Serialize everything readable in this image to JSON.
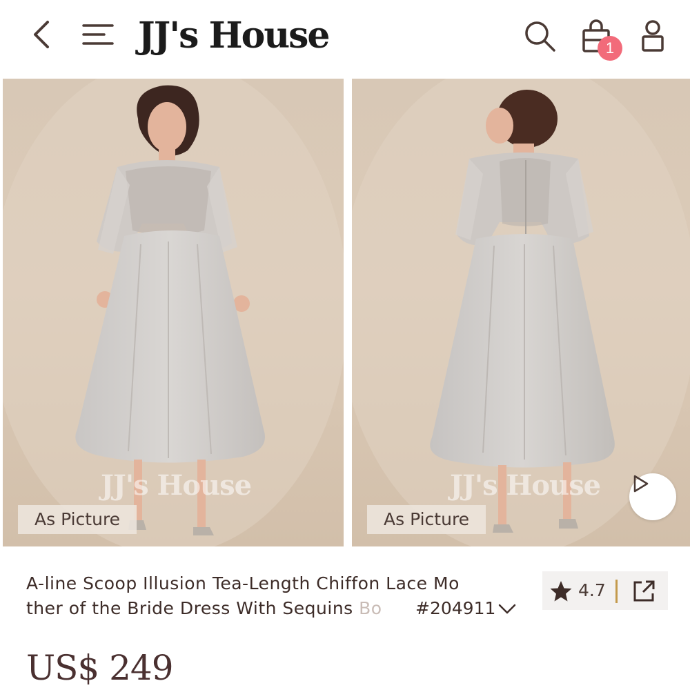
{
  "header": {
    "back_icon": "chevron-left-icon",
    "menu_icon": "hamburger-menu-icon",
    "logo": "JJ's House",
    "search_icon": "search-icon",
    "bag_icon": "shopping-bag-icon",
    "cart_count": "1",
    "account_icon": "user-icon",
    "badge_color": "#f26b7a"
  },
  "gallery": {
    "images": [
      {
        "label": "As Picture",
        "watermark": "JJ's House",
        "view": "front"
      },
      {
        "label": "As Picture",
        "watermark": "JJ's House",
        "view": "back",
        "has_video": true
      }
    ],
    "play_icon": "play-icon"
  },
  "product": {
    "title_line_1": "A-line Scoop Illusion Tea-Length Chiffon Lace Mo",
    "title_line_2": "ther of the Bride Dress With Sequins ",
    "title_fade": "Bo",
    "sku": "#204911",
    "expand_icon": "chevron-down-icon",
    "rating": "4.7",
    "rating_icon": "star-icon",
    "share_icon": "share-icon",
    "price": "US$ 249"
  },
  "colors": {
    "accent_gold": "#c39a4c",
    "text_dark": "#3d2c28",
    "price_color": "#4a3030"
  }
}
